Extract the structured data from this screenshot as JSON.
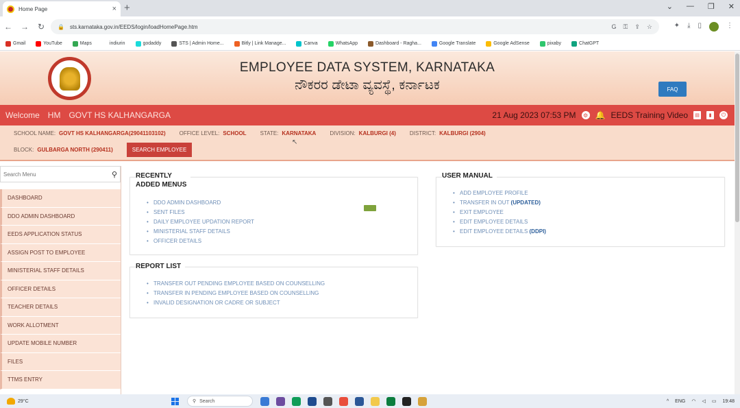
{
  "browser": {
    "tab_title": "Home Page",
    "tab_close": "×",
    "new_tab": "+",
    "window_controls": [
      "⌄",
      "—",
      "❐",
      "✕"
    ],
    "url": "sts.karnataka.gov.in/EEDS/login/loadHomePage.htm",
    "bookmarks": [
      {
        "label": "Gmail",
        "color": "#d93025"
      },
      {
        "label": "YouTube",
        "color": "#ff0000"
      },
      {
        "label": "Maps",
        "color": "#34a853"
      },
      {
        "label": "indiurin",
        "color": "#ffffff"
      },
      {
        "label": "godaddy",
        "color": "#1bdbdb"
      },
      {
        "label": "STS | Admin Home...",
        "color": "#555555"
      },
      {
        "label": "Bitly | Link Manage...",
        "color": "#ee6123"
      },
      {
        "label": "Canva",
        "color": "#00c4cc"
      },
      {
        "label": "WhatsApp",
        "color": "#25d366"
      },
      {
        "label": "Dashboard - Ragha...",
        "color": "#8b5a2b"
      },
      {
        "label": "Google Translate",
        "color": "#4285f4"
      },
      {
        "label": "Google AdSense",
        "color": "#fbbc04"
      },
      {
        "label": "pixaby",
        "color": "#2ec66d"
      },
      {
        "label": "ChatGPT",
        "color": "#10a37f"
      }
    ]
  },
  "header": {
    "title_en": "EMPLOYEE DATA SYSTEM, KARNATAKA",
    "title_kn": "ನೌಕರರ ಡೇಟಾ ವ್ಯವಸ್ಥೆ, ಕರ್ನಾಟಕ",
    "faq_label": "FAQ"
  },
  "welcome_bar": {
    "welcome": "Welcome",
    "role": "HM",
    "school": "GOVT HS KALHANGARGA",
    "datetime": "21 Aug 2023 07:53 PM",
    "training_video": "EEDS Training Video"
  },
  "info": {
    "school_name_label": "SCHOOL NAME:",
    "school_name_value": "GOVT HS KALHANGARGA(29041103102)",
    "office_level_label": "OFFICE LEVEL:",
    "office_level_value": "SCHOOL",
    "state_label": "STATE:",
    "state_value": "KARNATAKA",
    "division_label": "DIVISION:",
    "division_value": "KALBURGI (4)",
    "district_label": "DISTRICT:",
    "district_value": "KALBURGI (2904)",
    "block_label": "BLOCK:",
    "block_value": "GULBARGA NORTH (290411)",
    "search_employee_label": "SEARCH EMPLOYEE"
  },
  "sidebar": {
    "search_placeholder": "Search Menu",
    "items": [
      "DASHBOARD",
      "DDO ADMIN DASHBOARD",
      "EEDS APPLICATION STATUS",
      "ASSIGN POST TO EMPLOYEE",
      "MINISTERIAL STAFF DETAILS",
      "OFFICER DETAILS",
      "TEACHER DETAILS",
      "WORK ALLOTMENT",
      "UPDATE MOBILE NUMBER",
      "FILES",
      "TTMS ENTRY"
    ]
  },
  "recent_menus": {
    "title_line1": "RECENTLY",
    "title_line2": "ADDED MENUS",
    "links": [
      "DDO ADMIN DASHBOARD",
      "SENT FILES",
      "DAILY EMPLOYEE UPDATION REPORT",
      "MINISTERIAL STAFF DETAILS",
      "OFFICER DETAILS"
    ]
  },
  "report_list": {
    "title": "REPORT LIST",
    "links": [
      "TRANSFER OUT PENDING EMPLOYEE BASED ON COUNSELLING",
      "TRANSFER IN PENDING EMPLOYEE BASED ON COUNSELLING",
      "INVALID DESIGNATION OR CADRE OR SUBJECT"
    ]
  },
  "user_manual": {
    "title": "USER MANUAL",
    "links": [
      {
        "text": "ADD EMPLOYEE PROFILE",
        "tag": ""
      },
      {
        "text": "TRANSFER IN OUT ",
        "tag": "(UPDATED)"
      },
      {
        "text": "EXIT EMPLOYEE",
        "tag": ""
      },
      {
        "text": "EDIT EMPLOYEE DETAILS",
        "tag": ""
      },
      {
        "text": "EDIT EMPLOYEE DETAILS ",
        "tag": "(DDPI)"
      }
    ]
  },
  "taskbar": {
    "temperature": "29°C",
    "search_label": "Search",
    "lang": "ENG",
    "time": "19:48",
    "apps": [
      "#3a7bd5",
      "#6d4c9f",
      "#0f9d58",
      "#1e4c8f",
      "#555555",
      "#e94e3c",
      "#2b5797",
      "#f2c94c",
      "#0b7d3e",
      "#222222",
      "#d6a23a"
    ]
  }
}
